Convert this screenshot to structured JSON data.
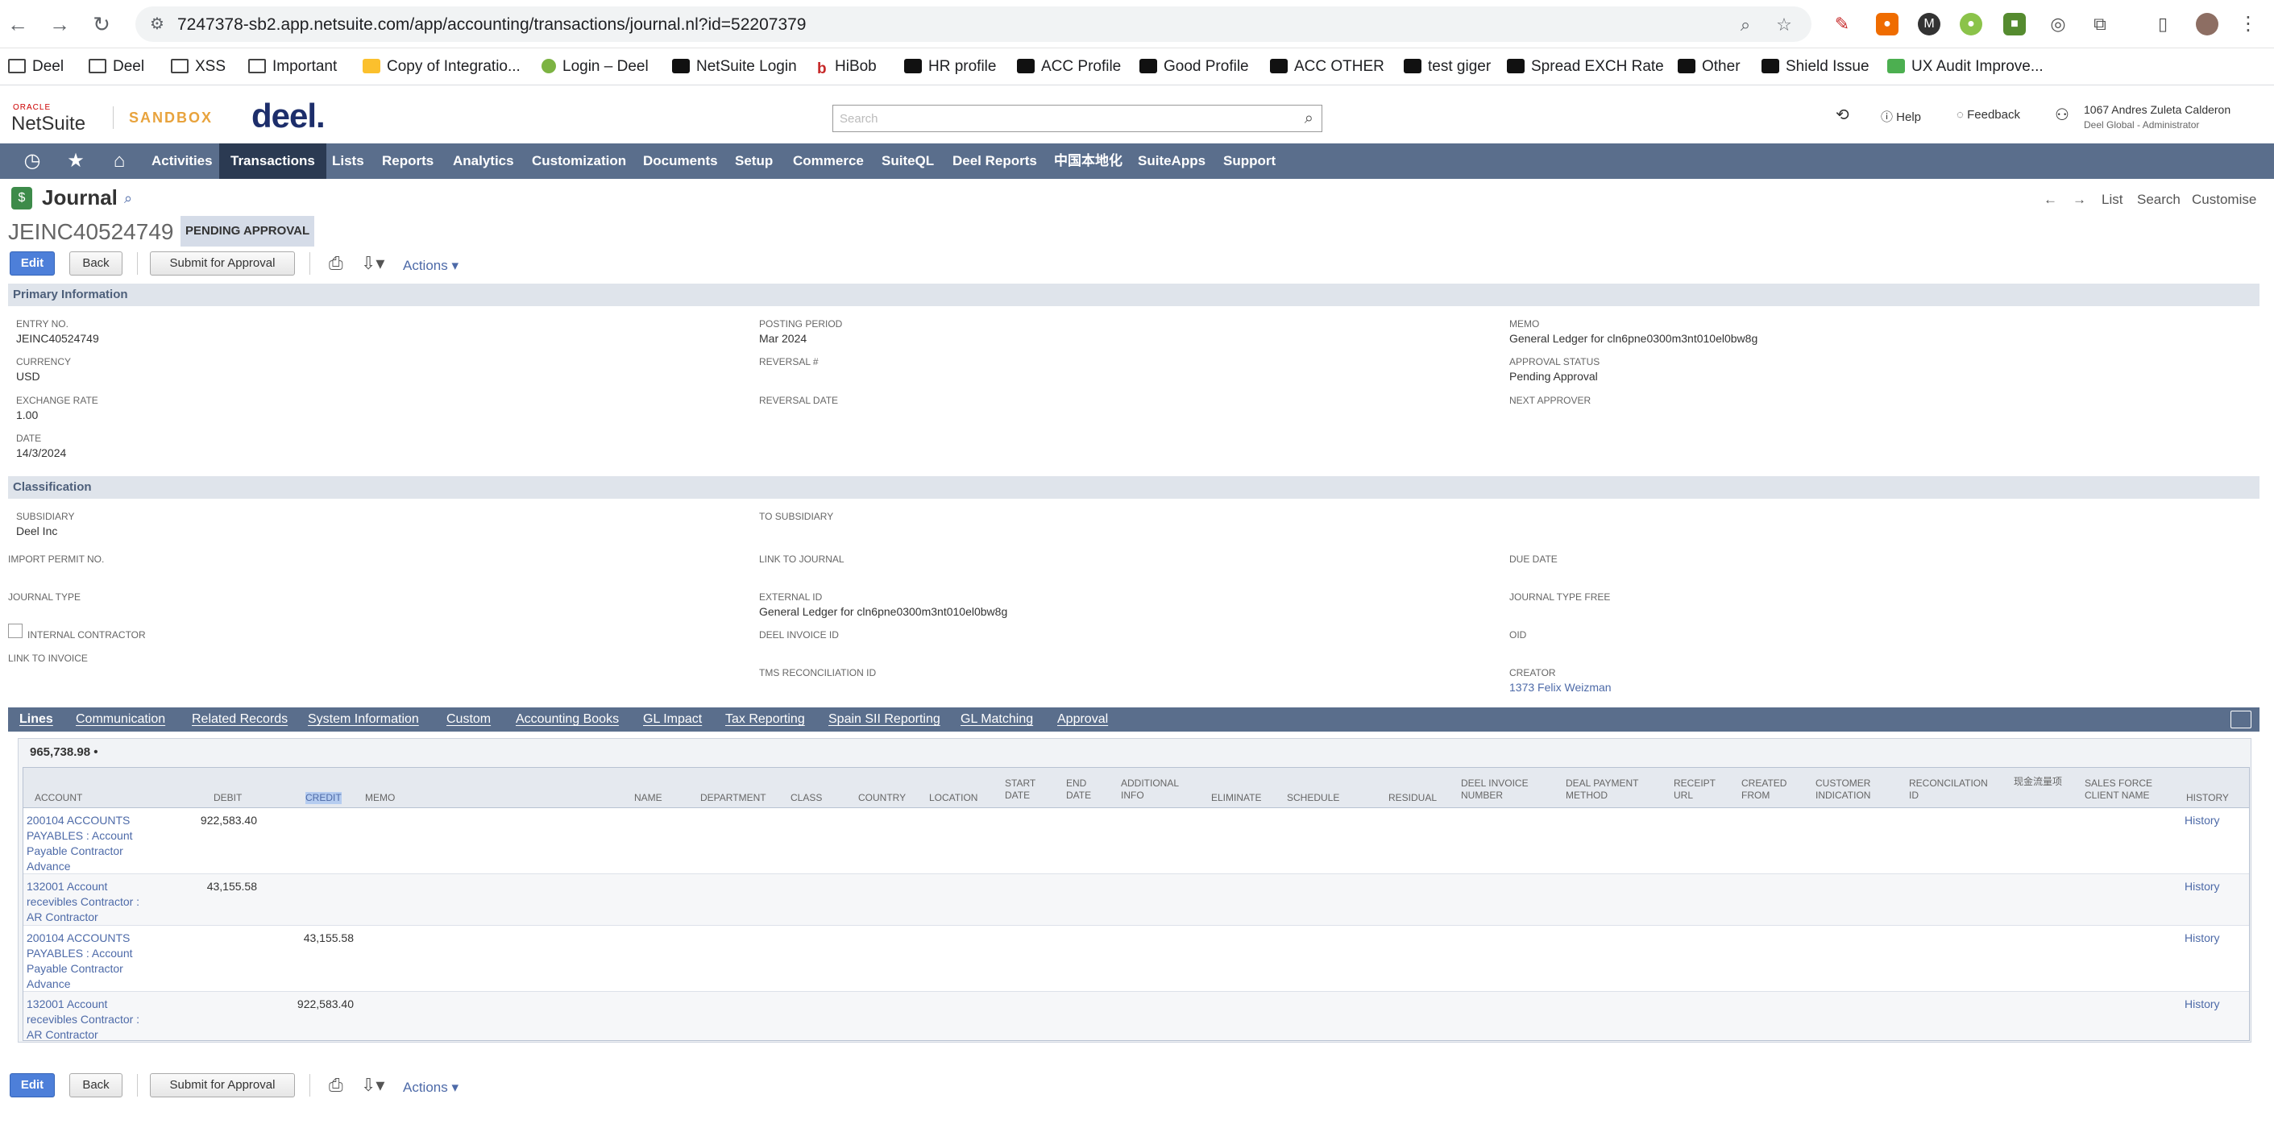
{
  "browser": {
    "url": "7247378-sb2.app.netsuite.com/app/accounting/transactions/journal.nl?id=52207379",
    "bookmarks": [
      "Deel",
      "Deel",
      "XSS",
      "Important",
      "Copy of Integratio...",
      "Login – Deel",
      "NetSuite Login",
      "HiBob",
      "HR profile",
      "ACC Profile",
      "Good Profile",
      "ACC OTHER",
      "test giger",
      "Spread EXCH Rate",
      "Other",
      "Shield Issue",
      "UX Audit Improve..."
    ]
  },
  "header": {
    "oracle": "ORACLE",
    "netsuite": "NetSuite",
    "sandbox": "SANDBOX",
    "brand": "deel.",
    "search_placeholder": "Search",
    "help": "Help",
    "feedback": "Feedback",
    "user_name": "1067 Andres Zuleta Calderon",
    "user_role": "Deel Global - Administrator"
  },
  "nav": [
    "Activities",
    "Transactions",
    "Lists",
    "Reports",
    "Analytics",
    "Customization",
    "Documents",
    "Setup",
    "Commerce",
    "SuiteQL",
    "Deel Reports",
    "中国本地化",
    "SuiteApps",
    "Support"
  ],
  "page": {
    "title": "Journal",
    "record_id": "JEINC40524749",
    "status": "PENDING APPROVAL",
    "nav_list": "List",
    "nav_search": "Search",
    "nav_customise": "Customise"
  },
  "buttons": {
    "edit": "Edit",
    "back": "Back",
    "submit": "Submit for Approval",
    "actions": "Actions"
  },
  "primary": {
    "section": "Primary Information",
    "entry_no_label": "ENTRY NO.",
    "entry_no": "JEINC40524749",
    "currency_label": "CURRENCY",
    "currency": "USD",
    "exchange_rate_label": "EXCHANGE RATE",
    "exchange_rate": "1.00",
    "date_label": "DATE",
    "date": "14/3/2024",
    "posting_period_label": "POSTING PERIOD",
    "posting_period": "Mar 2024",
    "reversal_no_label": "REVERSAL #",
    "reversal_date_label": "REVERSAL DATE",
    "memo_label": "MEMO",
    "memo": "General Ledger for cln6pne0300m3nt010el0bw8g",
    "approval_status_label": "APPROVAL STATUS",
    "approval_status": "Pending Approval",
    "next_approver_label": "NEXT APPROVER"
  },
  "classification": {
    "section": "Classification",
    "subsidiary_label": "SUBSIDIARY",
    "subsidiary": "Deel Inc",
    "to_subsidiary_label": "TO SUBSIDIARY",
    "import_permit_label": "IMPORT PERMIT NO.",
    "link_to_journal_label": "LINK TO JOURNAL",
    "due_date_label": "DUE DATE",
    "journal_type_label": "JOURNAL TYPE",
    "external_id_label": "EXTERNAL ID",
    "external_id": "General Ledger for cln6pne0300m3nt010el0bw8g",
    "journal_type_free_label": "JOURNAL TYPE FREE",
    "internal_contractor_label": "INTERNAL CONTRACTOR",
    "deel_invoice_id_label": "DEEL INVOICE ID",
    "oid_label": "OID",
    "link_to_invoice_label": "LINK TO INVOICE",
    "tms_label": "TMS RECONCILIATION ID",
    "creator_label": "CREATOR",
    "creator": "1373 Felix Weizman"
  },
  "subtabs": [
    "Lines",
    "Communication",
    "Related Records",
    "System Information",
    "Custom",
    "Accounting Books",
    "GL Impact",
    "Tax Reporting",
    "Spain SII Reporting",
    "GL Matching",
    "Approval"
  ],
  "lines": {
    "total": "965,738.98 •",
    "columns": [
      "ACCOUNT",
      "DEBIT",
      "CREDIT",
      "MEMO",
      "NAME",
      "DEPARTMENT",
      "CLASS",
      "COUNTRY",
      "LOCATION",
      "START DATE",
      "END DATE",
      "ADDITIONAL INFO",
      "ELIMINATE",
      "SCHEDULE",
      "RESIDUAL",
      "DEEL INVOICE NUMBER",
      "DEAL PAYMENT METHOD",
      "RECEIPT URL",
      "CREATED FROM",
      "CUSTOMER INDICATION",
      "RECONCILATION ID",
      "现金流量项",
      "SALES FORCE CLIENT NAME",
      "HISTORY"
    ],
    "rows": [
      {
        "account": [
          "200104 ACCOUNTS",
          "PAYABLES : Account",
          "Payable Contractor",
          "Advance"
        ],
        "debit": "922,583.40",
        "credit": "",
        "history": "History"
      },
      {
        "account": [
          "132001 Account",
          "recevibles Contractor :",
          "AR Contractor"
        ],
        "debit": "43,155.58",
        "credit": "",
        "history": "History"
      },
      {
        "account": [
          "200104 ACCOUNTS",
          "PAYABLES : Account",
          "Payable Contractor",
          "Advance"
        ],
        "debit": "",
        "credit": "43,155.58",
        "history": "History"
      },
      {
        "account": [
          "132001 Account",
          "recevibles Contractor :",
          "AR Contractor"
        ],
        "debit": "",
        "credit": "922,583.40",
        "history": "History"
      }
    ]
  }
}
